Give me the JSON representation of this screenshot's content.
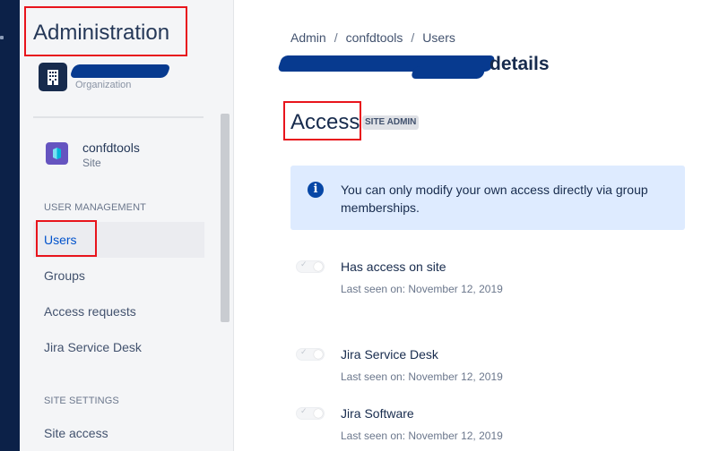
{
  "sidebar": {
    "title": "Administration",
    "org": {
      "subtitle": "Organization"
    },
    "site": {
      "name": "confdtools",
      "type": "Site"
    },
    "sections": [
      {
        "heading": "USER MANAGEMENT",
        "items": [
          "Users",
          "Groups",
          "Access requests",
          "Jira Service Desk"
        ]
      },
      {
        "heading": "SITE SETTINGS",
        "items": [
          "Site access"
        ]
      }
    ]
  },
  "breadcrumb": [
    "Admin",
    "confdtools",
    "Users"
  ],
  "page": {
    "title_suffix": "details"
  },
  "access": {
    "title": "Access",
    "badge": "SITE ADMIN",
    "info": "You can only modify your own access directly via group memberships.",
    "products": [
      {
        "name": "Has access on site",
        "last_seen": "Last seen on: November 12, 2019",
        "enabled": false
      },
      {
        "name": "Jira Service Desk",
        "last_seen": "Last seen on: November 12, 2019",
        "enabled": false
      },
      {
        "name": "Jira Software",
        "last_seen": "Last seen on: November 12, 2019",
        "enabled": false
      }
    ]
  },
  "colors": {
    "accent": "#0052cc",
    "highlight": "#e8141c",
    "info_bg": "#deebff"
  }
}
